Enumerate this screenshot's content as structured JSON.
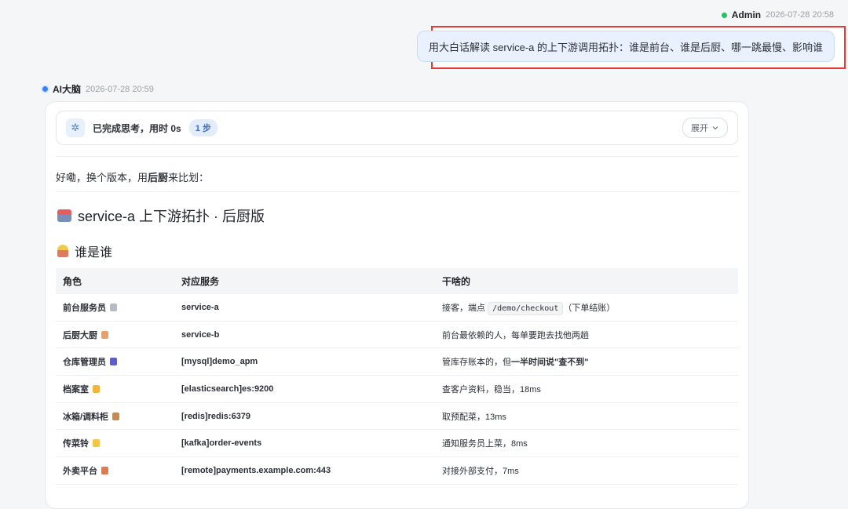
{
  "user": {
    "name": "Admin",
    "time": "2026-07-28 20:58",
    "message": "用大白话解读 service-a 的上下游调用拓扑：谁是前台、谁是后厨、哪一跳最慢、影响谁"
  },
  "ai": {
    "name": "AI大脑",
    "time": "2026-07-28 20:59"
  },
  "thinking": {
    "label": "已完成思考，用时 0s",
    "steps": "1 步",
    "expand": "展开"
  },
  "intro": {
    "pre": "好嘞，换个版本，用",
    "bold": "后厨",
    "post": "来比划："
  },
  "heading1": "service-a 上下游拓扑 · 后厨版",
  "heading2": "谁是谁",
  "table": {
    "headers": [
      "角色",
      "对应服务",
      "干啥的"
    ],
    "rows": [
      {
        "role": "前台服务员",
        "icon": "clipboard-icon",
        "icon_color": "#b7bcc4",
        "service": "service-a",
        "desc_pre": "接客，端点 ",
        "code": "/demo/checkout",
        "desc_post": "（下单结账）"
      },
      {
        "role": "后厨大厨",
        "icon": "chef-icon",
        "icon_color": "#e8a06a",
        "service": "service-b",
        "desc": "前台最依赖的人，每单要跑去找他两趟"
      },
      {
        "role": "仓库管理员",
        "icon": "phone-icon",
        "icon_color": "#5b5fc7",
        "service": "[mysql]demo_apm",
        "desc_pre": "管库存账本的，但",
        "desc_bold": "一半时间说\"查不到\""
      },
      {
        "role": "档案室",
        "icon": "folder-icon",
        "icon_color": "#f2b73a",
        "service": "[elasticsearch]es:9200",
        "desc": "查客户资料，稳当，18ms"
      },
      {
        "role": "冰箱/调料柜",
        "icon": "box-icon",
        "icon_color": "#c98a52",
        "service": "[redis]redis:6379",
        "desc": "取预配菜，13ms"
      },
      {
        "role": "传菜铃",
        "icon": "bell-icon",
        "icon_color": "#f4c542",
        "service": "[kafka]order-events",
        "desc": "通知服务员上菜，8ms"
      },
      {
        "role": "外卖平台",
        "icon": "bike-icon",
        "icon_color": "#e07a4f",
        "service": "[remote]payments.example.com:443",
        "desc": "对接外部支付，7ms"
      }
    ]
  }
}
